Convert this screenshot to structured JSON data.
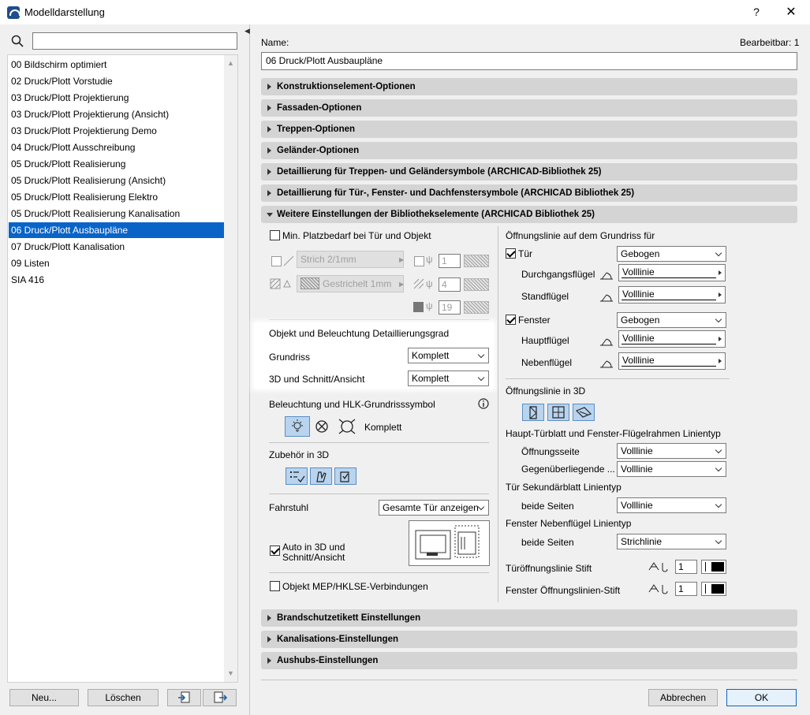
{
  "window": {
    "title": "Modelldarstellung",
    "help": "?",
    "close": "✕"
  },
  "search": {
    "placeholder": ""
  },
  "list": {
    "items": [
      "00 Bildschirm optimiert",
      "02 Druck/Plott Vorstudie",
      "03 Druck/Plott Projektierung",
      "03 Druck/Plott Projektierung (Ansicht)",
      "03 Druck/Plott Projektierung Demo",
      "04 Druck/Plott Ausschreibung",
      "05 Druck/Plott Realisierung",
      "05 Druck/Plott Realisierung (Ansicht)",
      "05 Druck/Plott Realisierung Elektro",
      "05 Druck/Plott Realisierung Kanalisation",
      "06 Druck/Plott Ausbaupläne",
      "07 Druck/Plott Kanalisation",
      "09 Listen",
      "SIA 416"
    ],
    "selected_index": 10
  },
  "left_buttons": {
    "new": "Neu...",
    "delete": "Löschen"
  },
  "name": {
    "label": "Name:",
    "value": "06 Druck/Plott Ausbaupläne",
    "editable": "Bearbeitbar: 1"
  },
  "sections": [
    "Konstruktionselement-Optionen",
    "Fassaden-Optionen",
    "Treppen-Optionen",
    "Geländer-Optionen",
    "Detaillierung für Treppen- und Geländersymbole (ARCHICAD-Bibliothek 25)",
    "Detaillierung für Tür-, Fenster- und Dachfenstersymbole (ARCHICAD Bibliothek 25)",
    "Weitere Einstellungen der Bibliothekselemente (ARCHICAD Bibliothek 25)"
  ],
  "bottom_sections": [
    "Brandschutzetikett Einstellungen",
    "Kanalisations-Einstellungen",
    "Aushubs-Einstellungen"
  ],
  "left_col": {
    "min_space": "Min. Platzbedarf bei Tür und Objekt",
    "line1": "Strich 2/1mm",
    "line2": "Gestrichelt 1mm",
    "pen1": "1",
    "pen2": "4",
    "pen3": "19",
    "detail_title": "Objekt und Beleuchtung Detaillierungsgrad",
    "grundriss_label": "Grundriss",
    "grundriss_value": "Komplett",
    "schnitt_label": "3D und Schnitt/Ansicht",
    "schnitt_value": "Komplett",
    "lighting_title": "Beleuchtung und HLK-Grundrisssymbol",
    "lighting_value": "Komplett",
    "zubehor_title": "Zubehör in 3D",
    "fahrstuhl_label": "Fahrstuhl",
    "fahrstuhl_value": "Gesamte Tür anzeigen",
    "auto3d": "Auto in 3D und",
    "auto3d2": "Schnitt/Ansicht",
    "mep": "Objekt MEP/HKLSE-Verbindungen"
  },
  "right_col": {
    "opening_title": "Öffnungslinie auf dem Grundriss für",
    "door": "Tür",
    "door_value": "Gebogen",
    "durchgang": "Durchgangsflügel",
    "durchgang_value": "Volllinie",
    "stand": "Standflügel",
    "stand_value": "Volllinie",
    "window": "Fenster",
    "window_value": "Gebogen",
    "haupt": "Hauptflügel",
    "haupt_value": "Volllinie",
    "neben": "Nebenflügel",
    "neben_value": "Volllinie",
    "opening3d": "Öffnungslinie in 3D",
    "frame_title": "Haupt-Türblatt und Fenster-Flügelrahmen Linientyp",
    "offnungsseite": "Öffnungsseite",
    "offnungsseite_value": "Volllinie",
    "gegen": "Gegenüberliegende ...",
    "gegen_value": "Volllinie",
    "sek_title": "Tür Sekundärblatt Linientyp",
    "beide1": "beide Seiten",
    "beide1_value": "Volllinie",
    "nebenf_title": "Fenster Nebenflügel Linientyp",
    "beide2": "beide Seiten",
    "beide2_value": "Strichlinie",
    "door_pen": "Türöffnungslinie Stift",
    "door_pen_value": "1",
    "win_pen": "Fenster Öffnungslinien-Stift",
    "win_pen_value": "1"
  },
  "footer": {
    "cancel": "Abbrechen",
    "ok": "OK"
  }
}
